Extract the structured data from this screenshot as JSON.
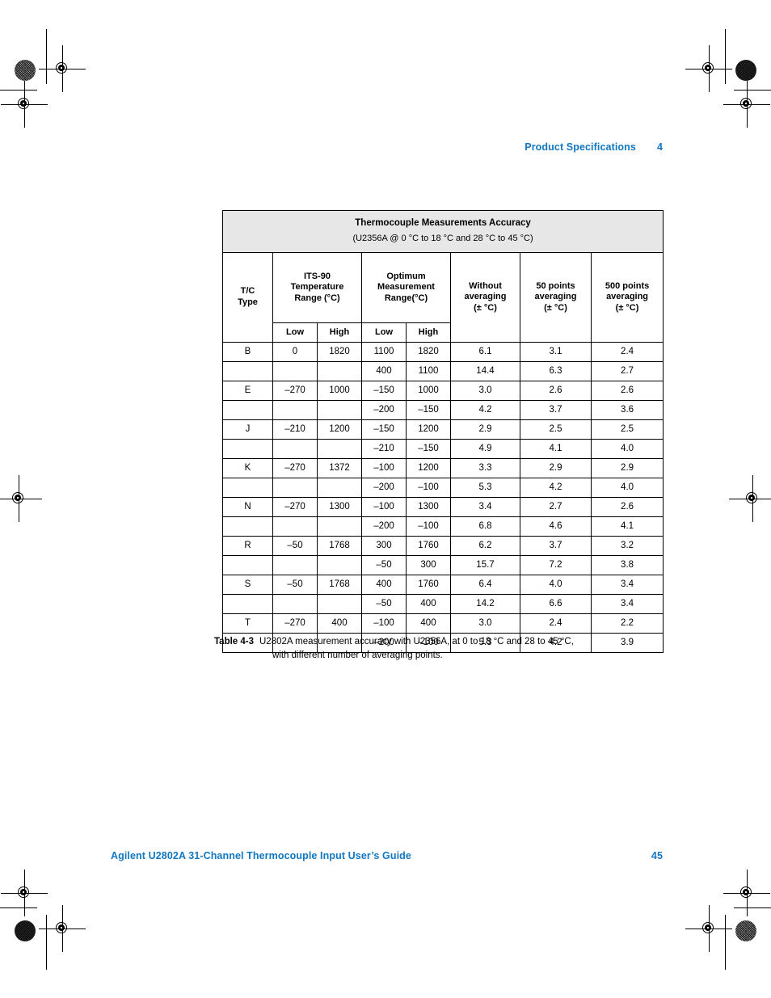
{
  "header": {
    "section_title": "Product Specifications",
    "chapter_number": "4"
  },
  "footer": {
    "guide_title": "Agilent U2802A 31-Channel Thermocouple Input User’s Guide",
    "page_number": "45"
  },
  "table": {
    "title": "Thermocouple Measurements Accuracy",
    "subtitle": "(U2356A @ 0 °C to 18 °C and 28 °C to 45 °C)",
    "headers": {
      "tc_type_line1": "T/C",
      "tc_type_line2": "Type",
      "its90_line1": "ITS-90",
      "its90_line2": "Temperature",
      "its90_line3": "Range (°C)",
      "optimum_line1": "Optimum",
      "optimum_line2": "Measurement",
      "optimum_line3": "Range(°C)",
      "without_line1": "Without",
      "without_line2": "averaging",
      "without_line3": "(± °C)",
      "avg50_line1": "50 points",
      "avg50_line2": "averaging",
      "avg50_line3": "(± °C)",
      "avg500_line1": "500 points",
      "avg500_line2": "averaging",
      "avg500_line3": "(± °C)",
      "its90_low": "Low",
      "its90_high": "High",
      "optimum_low": "Low",
      "optimum_high": "High"
    },
    "rows": [
      {
        "tc": "B",
        "its_low": "0",
        "its_high": "1820",
        "opt_low": "1100",
        "opt_high": "1820",
        "no_avg": "6.1",
        "avg50": "3.1",
        "avg500": "2.4"
      },
      {
        "tc": "",
        "its_low": "",
        "its_high": "",
        "opt_low": "400",
        "opt_high": "1100",
        "no_avg": "14.4",
        "avg50": "6.3",
        "avg500": "2.7"
      },
      {
        "tc": "E",
        "its_low": "–270",
        "its_high": "1000",
        "opt_low": "–150",
        "opt_high": "1000",
        "no_avg": "3.0",
        "avg50": "2.6",
        "avg500": "2.6"
      },
      {
        "tc": "",
        "its_low": "",
        "its_high": "",
        "opt_low": "–200",
        "opt_high": "–150",
        "no_avg": "4.2",
        "avg50": "3.7",
        "avg500": "3.6"
      },
      {
        "tc": "J",
        "its_low": "–210",
        "its_high": "1200",
        "opt_low": "–150",
        "opt_high": "1200",
        "no_avg": "2.9",
        "avg50": "2.5",
        "avg500": "2.5"
      },
      {
        "tc": "",
        "its_low": "",
        "its_high": "",
        "opt_low": "–210",
        "opt_high": "–150",
        "no_avg": "4.9",
        "avg50": "4.1",
        "avg500": "4.0"
      },
      {
        "tc": "K",
        "its_low": "–270",
        "its_high": "1372",
        "opt_low": "–100",
        "opt_high": "1200",
        "no_avg": "3.3",
        "avg50": "2.9",
        "avg500": "2.9"
      },
      {
        "tc": "",
        "its_low": "",
        "its_high": "",
        "opt_low": "–200",
        "opt_high": "–100",
        "no_avg": "5.3",
        "avg50": "4.2",
        "avg500": "4.0"
      },
      {
        "tc": "N",
        "its_low": "–270",
        "its_high": "1300",
        "opt_low": "–100",
        "opt_high": "1300",
        "no_avg": "3.4",
        "avg50": "2.7",
        "avg500": "2.6"
      },
      {
        "tc": "",
        "its_low": "",
        "its_high": "",
        "opt_low": "–200",
        "opt_high": "–100",
        "no_avg": "6.8",
        "avg50": "4.6",
        "avg500": "4.1"
      },
      {
        "tc": "R",
        "its_low": "–50",
        "its_high": "1768",
        "opt_low": "300",
        "opt_high": "1760",
        "no_avg": "6.2",
        "avg50": "3.7",
        "avg500": "3.2"
      },
      {
        "tc": "",
        "its_low": "",
        "its_high": "",
        "opt_low": "–50",
        "opt_high": "300",
        "no_avg": "15.7",
        "avg50": "7.2",
        "avg500": "3.8"
      },
      {
        "tc": "S",
        "its_low": "–50",
        "its_high": "1768",
        "opt_low": "400",
        "opt_high": "1760",
        "no_avg": "6.4",
        "avg50": "4.0",
        "avg500": "3.4"
      },
      {
        "tc": "",
        "its_low": "",
        "its_high": "",
        "opt_low": "–50",
        "opt_high": "400",
        "no_avg": "14.2",
        "avg50": "6.6",
        "avg500": "3.4"
      },
      {
        "tc": "T",
        "its_low": "–270",
        "its_high": "400",
        "opt_low": "–100",
        "opt_high": "400",
        "no_avg": "3.0",
        "avg50": "2.4",
        "avg500": "2.2"
      },
      {
        "tc": "",
        "its_low": "",
        "its_high": "",
        "opt_low": "–200",
        "opt_high": "–100",
        "no_avg": "5.3",
        "avg50": "4.2",
        "avg500": "3.9"
      }
    ]
  },
  "caption": {
    "label": "Table 4-3",
    "line1": "U2802A measurement accuracy with U2356A, at 0 to 18  °C and 28 to 45 °C,",
    "line2": "with different number of averaging points."
  },
  "colors": {
    "accent_blue": "#1277c0",
    "table_title_background": "#e7e7e7",
    "rule": "#000000"
  }
}
